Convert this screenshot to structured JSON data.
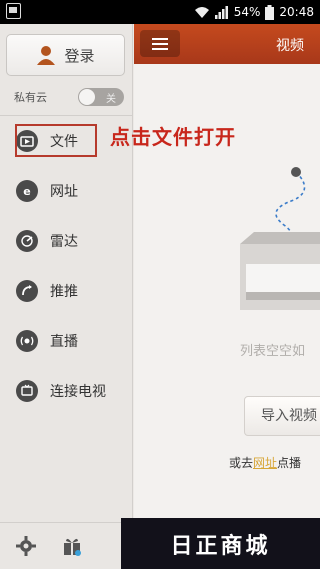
{
  "status_bar": {
    "battery": "54%",
    "time": "20:48"
  },
  "sidebar": {
    "login_label": "登录",
    "private_cloud_label": "私有云",
    "private_cloud_toggle": "关",
    "items": [
      {
        "label": "文件",
        "icon": "file-icon"
      },
      {
        "label": "网址",
        "icon": "web-icon"
      },
      {
        "label": "雷达",
        "icon": "radar-icon"
      },
      {
        "label": "推推",
        "icon": "push-icon"
      },
      {
        "label": "直播",
        "icon": "live-icon"
      },
      {
        "label": "连接电视",
        "icon": "tv-icon"
      }
    ],
    "footer_icons": [
      "settings-icon",
      "gift-icon"
    ]
  },
  "annotation": "点击文件打开",
  "main": {
    "title": "视频",
    "empty_text": "列表空空如",
    "import_button": "导入视频",
    "hint_prefix": "或去",
    "hint_link": "网址",
    "hint_suffix": "点播"
  },
  "watermark": "日正商城",
  "colors": {
    "accent": "#b7421c",
    "annotation": "#c8271c",
    "link": "#d7a637"
  }
}
